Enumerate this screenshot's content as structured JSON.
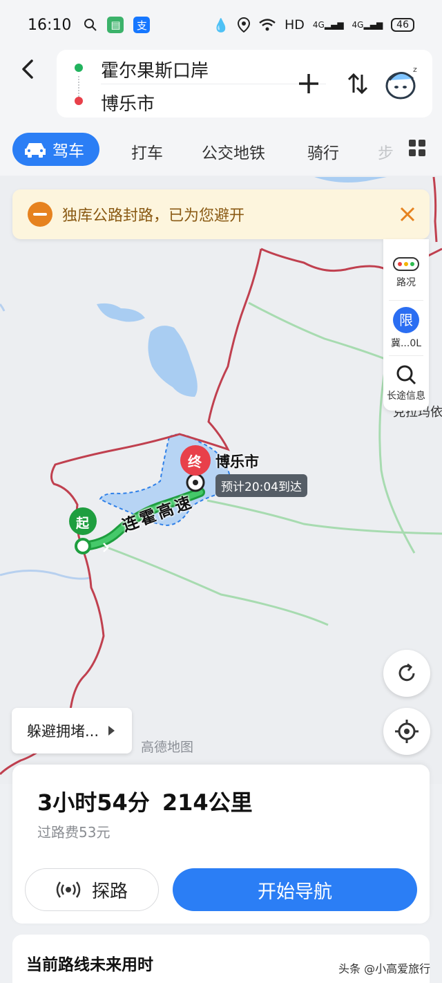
{
  "status_bar": {
    "time": "16:10",
    "network": "HD",
    "signal_1": "4G",
    "signal_2": "4G",
    "battery": "46"
  },
  "route": {
    "origin": "霍尔果斯口岸",
    "destination": "博乐市",
    "add_icon": "plus-icon",
    "swap_icon": "swap-icon"
  },
  "tabs": {
    "active": "驾车",
    "items": [
      "打车",
      "公交地铁",
      "骑行",
      "步"
    ]
  },
  "notice": {
    "text": "独库公路封路，已为您避开"
  },
  "side_panel": {
    "traffic": "路况",
    "limit_badge": "限",
    "limit_label": "冀...0L",
    "long_trip": "长途信息"
  },
  "map": {
    "end_marker": "终",
    "start_marker": "起",
    "end_city": "博乐市",
    "eta": "预计20:04到达",
    "road_name": "连霍高速",
    "partial_label": "克拉玛依",
    "watermark": "高德地图"
  },
  "avoid": {
    "label": "躲避拥堵..."
  },
  "summary": {
    "duration": "3小时54分",
    "distance": "214公里",
    "toll": "过路费53元",
    "explore_label": "探路",
    "nav_label": "开始导航"
  },
  "future": {
    "title": "当前路线未来用时"
  },
  "footer": {
    "watermark": "头条 @小高爱旅行"
  },
  "colors": {
    "accent": "#2b7ef5",
    "route_green": "#1e9e3f",
    "end_red": "#e8404a",
    "border_red": "#c0404f",
    "notice_orange": "#e6821f"
  }
}
